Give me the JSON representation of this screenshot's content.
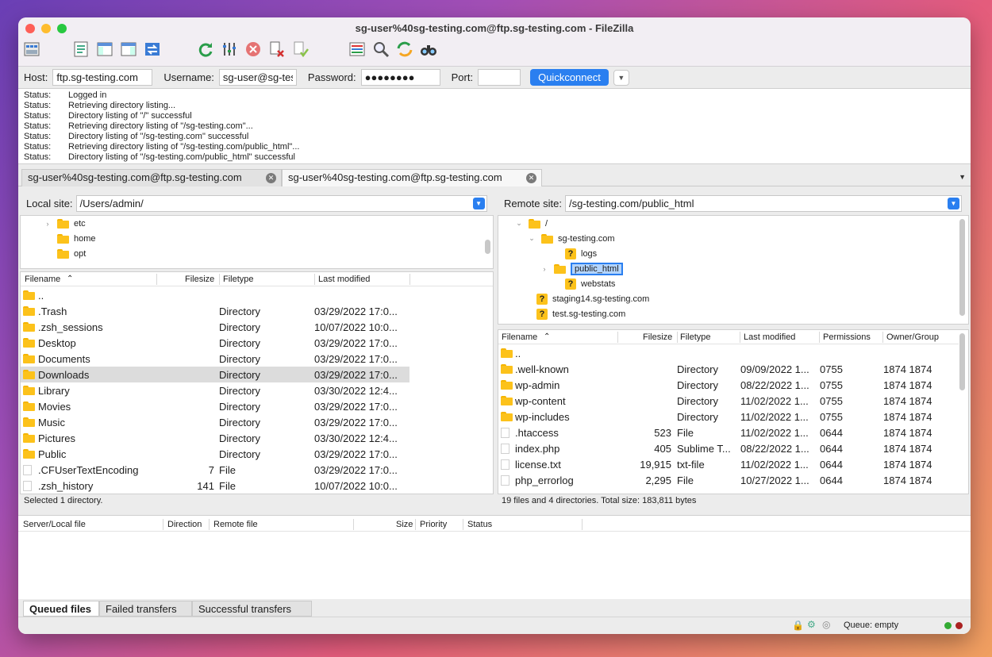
{
  "window": {
    "title": "sg-user%40sg-testing.com@ftp.sg-testing.com - FileZilla"
  },
  "toolbar_icons": [
    "site-manager-icon",
    "toggle-message-log-icon",
    "toggle-local-tree-icon",
    "toggle-remote-tree-icon",
    "toggle-transfer-queue-icon",
    "refresh-icon",
    "process-queue-icon",
    "cancel-icon",
    "disconnect-icon",
    "reconnect-icon",
    "directory-filters-icon",
    "search-icon",
    "synchronized-browsing-icon",
    "find-files-icon"
  ],
  "quickconnect": {
    "host_label": "Host:",
    "host_value": "ftp.sg-testing.com",
    "username_label": "Username:",
    "username_value": "sg-user@sg-tes",
    "password_label": "Password:",
    "password_value": "●●●●●●●●",
    "port_label": "Port:",
    "port_value": "",
    "button": "Quickconnect"
  },
  "log": [
    {
      "k": "Status:",
      "v": "Logged in"
    },
    {
      "k": "Status:",
      "v": "Retrieving directory listing..."
    },
    {
      "k": "Status:",
      "v": "Directory listing of \"/\" successful"
    },
    {
      "k": "Status:",
      "v": "Retrieving directory listing of \"/sg-testing.com\"..."
    },
    {
      "k": "Status:",
      "v": "Directory listing of \"/sg-testing.com\" successful"
    },
    {
      "k": "Status:",
      "v": "Retrieving directory listing of \"/sg-testing.com/public_html\"..."
    },
    {
      "k": "Status:",
      "v": "Directory listing of \"/sg-testing.com/public_html\" successful"
    }
  ],
  "tabs": [
    "sg-user%40sg-testing.com@ftp.sg-testing.com",
    "sg-user%40sg-testing.com@ftp.sg-testing.com"
  ],
  "local": {
    "site_label": "Local site:",
    "path": "/Users/admin/",
    "tree": [
      "etc",
      "home",
      "opt"
    ],
    "headers": [
      "Filename",
      "Filesize",
      "Filetype",
      "Last modified"
    ],
    "files": [
      {
        "name": "..",
        "size": "",
        "type": "",
        "mod": "",
        "kind": "folder"
      },
      {
        "name": ".Trash",
        "size": "",
        "type": "Directory",
        "mod": "03/29/2022 17:0...",
        "kind": "folder"
      },
      {
        "name": ".zsh_sessions",
        "size": "",
        "type": "Directory",
        "mod": "10/07/2022 10:0...",
        "kind": "folder"
      },
      {
        "name": "Desktop",
        "size": "",
        "type": "Directory",
        "mod": "03/29/2022 17:0...",
        "kind": "folder"
      },
      {
        "name": "Documents",
        "size": "",
        "type": "Directory",
        "mod": "03/29/2022 17:0...",
        "kind": "folder"
      },
      {
        "name": "Downloads",
        "size": "",
        "type": "Directory",
        "mod": "03/29/2022 17:0...",
        "kind": "folder"
      },
      {
        "name": "Library",
        "size": "",
        "type": "Directory",
        "mod": "03/30/2022 12:4...",
        "kind": "folder"
      },
      {
        "name": "Movies",
        "size": "",
        "type": "Directory",
        "mod": "03/29/2022 17:0...",
        "kind": "folder"
      },
      {
        "name": "Music",
        "size": "",
        "type": "Directory",
        "mod": "03/29/2022 17:0...",
        "kind": "folder"
      },
      {
        "name": "Pictures",
        "size": "",
        "type": "Directory",
        "mod": "03/30/2022 12:4...",
        "kind": "folder"
      },
      {
        "name": "Public",
        "size": "",
        "type": "Directory",
        "mod": "03/29/2022 17:0...",
        "kind": "folder"
      },
      {
        "name": ".CFUserTextEncoding",
        "size": "7",
        "type": "File",
        "mod": "03/29/2022 17:0...",
        "kind": "file"
      },
      {
        "name": ".zsh_history",
        "size": "141",
        "type": "File",
        "mod": "10/07/2022 10:0...",
        "kind": "file"
      }
    ],
    "selected": "Downloads",
    "status": "Selected 1 directory."
  },
  "remote": {
    "site_label": "Remote site:",
    "path": "/sg-testing.com/public_html",
    "tree": [
      {
        "label": "/",
        "kind": "folder"
      },
      {
        "label": "sg-testing.com",
        "kind": "folder"
      },
      {
        "label": "logs",
        "kind": "unknown"
      },
      {
        "label": "public_html",
        "kind": "folder"
      },
      {
        "label": "webstats",
        "kind": "unknown"
      },
      {
        "label": "staging14.sg-testing.com",
        "kind": "unknown"
      },
      {
        "label": "test.sg-testing.com",
        "kind": "unknown"
      }
    ],
    "headers": [
      "Filename",
      "Filesize",
      "Filetype",
      "Last modified",
      "Permissions",
      "Owner/Group"
    ],
    "files": [
      {
        "name": "..",
        "size": "",
        "type": "",
        "mod": "",
        "perm": "",
        "owner": "",
        "kind": "folder"
      },
      {
        "name": ".well-known",
        "size": "",
        "type": "Directory",
        "mod": "09/09/2022 1...",
        "perm": "0755",
        "owner": "1874 1874",
        "kind": "folder"
      },
      {
        "name": "wp-admin",
        "size": "",
        "type": "Directory",
        "mod": "08/22/2022 1...",
        "perm": "0755",
        "owner": "1874 1874",
        "kind": "folder"
      },
      {
        "name": "wp-content",
        "size": "",
        "type": "Directory",
        "mod": "11/02/2022 1...",
        "perm": "0755",
        "owner": "1874 1874",
        "kind": "folder"
      },
      {
        "name": "wp-includes",
        "size": "",
        "type": "Directory",
        "mod": "11/02/2022 1...",
        "perm": "0755",
        "owner": "1874 1874",
        "kind": "folder"
      },
      {
        "name": ".htaccess",
        "size": "523",
        "type": "File",
        "mod": "11/02/2022 1...",
        "perm": "0644",
        "owner": "1874 1874",
        "kind": "file"
      },
      {
        "name": "index.php",
        "size": "405",
        "type": "Sublime T...",
        "mod": "08/22/2022 1...",
        "perm": "0644",
        "owner": "1874 1874",
        "kind": "file"
      },
      {
        "name": "license.txt",
        "size": "19,915",
        "type": "txt-file",
        "mod": "11/02/2022 1...",
        "perm": "0644",
        "owner": "1874 1874",
        "kind": "file"
      },
      {
        "name": "php_errorlog",
        "size": "2,295",
        "type": "File",
        "mod": "10/27/2022 1...",
        "perm": "0644",
        "owner": "1874 1874",
        "kind": "file"
      }
    ],
    "status": "19 files and 4 directories. Total size: 183,811 bytes"
  },
  "queue": {
    "headers": [
      "Server/Local file",
      "Direction",
      "Remote file",
      "Size",
      "Priority",
      "Status"
    ]
  },
  "bottom_tabs": [
    "Queued files",
    "Failed transfers",
    "Successful transfers"
  ],
  "statusbar": {
    "queue": "Queue: empty"
  }
}
